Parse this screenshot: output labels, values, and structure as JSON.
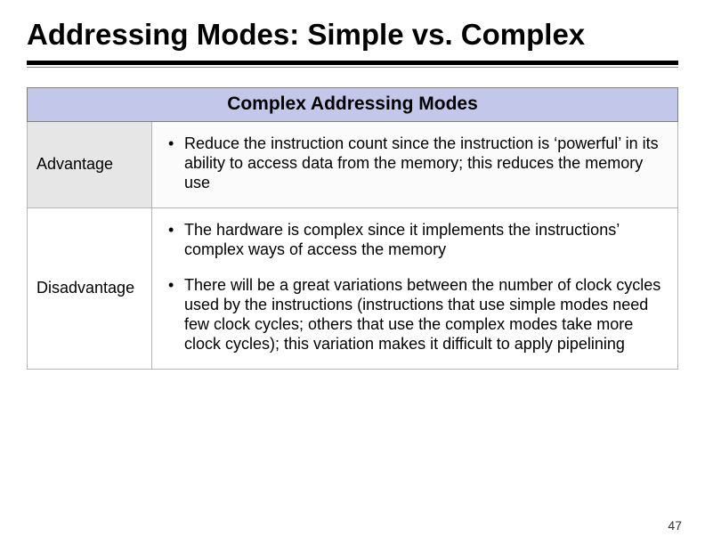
{
  "title": "Addressing Modes: Simple vs. Complex",
  "table": {
    "header": "Complex Addressing Modes",
    "rows": {
      "advantage_label": "Advantage",
      "advantage_bullet": "Reduce the instruction count since the instruction is ‘powerful’ in its ability to access data from the memory; this reduces the memory use",
      "disadvantage_label": "Disadvantage",
      "disadvantage_b1": "The hardware is complex since it implements the instructions’ complex ways of access the memory",
      "disadvantage_b2": "There will be a great variations between the number of clock cycles used by the instructions (instructions that use simple modes need few clock cycles; others that use the complex modes take more clock cycles); this variation makes it difficult to apply pipelining"
    }
  },
  "page_number": "47"
}
